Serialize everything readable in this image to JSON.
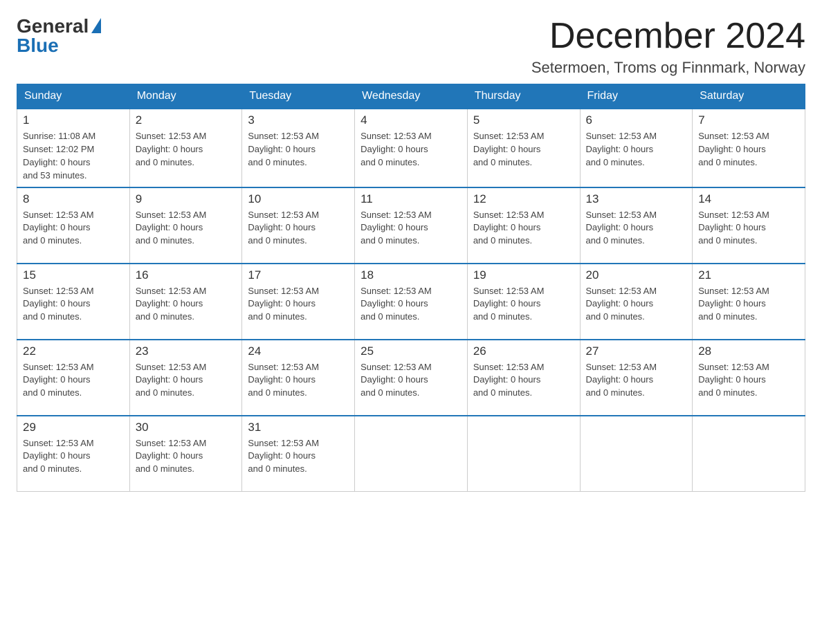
{
  "logo": {
    "general": "General",
    "blue": "Blue"
  },
  "title": {
    "month_year": "December 2024",
    "location": "Setermoen, Troms og Finnmark, Norway"
  },
  "headers": [
    "Sunday",
    "Monday",
    "Tuesday",
    "Wednesday",
    "Thursday",
    "Friday",
    "Saturday"
  ],
  "weeks": [
    [
      {
        "day": "1",
        "info": "Sunrise: 11:08 AM\nSunset: 12:02 PM\nDaylight: 0 hours\nand 53 minutes."
      },
      {
        "day": "2",
        "info": "Sunset: 12:53 AM\nDaylight: 0 hours\nand 0 minutes."
      },
      {
        "day": "3",
        "info": "Sunset: 12:53 AM\nDaylight: 0 hours\nand 0 minutes."
      },
      {
        "day": "4",
        "info": "Sunset: 12:53 AM\nDaylight: 0 hours\nand 0 minutes."
      },
      {
        "day": "5",
        "info": "Sunset: 12:53 AM\nDaylight: 0 hours\nand 0 minutes."
      },
      {
        "day": "6",
        "info": "Sunset: 12:53 AM\nDaylight: 0 hours\nand 0 minutes."
      },
      {
        "day": "7",
        "info": "Sunset: 12:53 AM\nDaylight: 0 hours\nand 0 minutes."
      }
    ],
    [
      {
        "day": "8",
        "info": "Sunset: 12:53 AM\nDaylight: 0 hours\nand 0 minutes."
      },
      {
        "day": "9",
        "info": "Sunset: 12:53 AM\nDaylight: 0 hours\nand 0 minutes."
      },
      {
        "day": "10",
        "info": "Sunset: 12:53 AM\nDaylight: 0 hours\nand 0 minutes."
      },
      {
        "day": "11",
        "info": "Sunset: 12:53 AM\nDaylight: 0 hours\nand 0 minutes."
      },
      {
        "day": "12",
        "info": "Sunset: 12:53 AM\nDaylight: 0 hours\nand 0 minutes."
      },
      {
        "day": "13",
        "info": "Sunset: 12:53 AM\nDaylight: 0 hours\nand 0 minutes."
      },
      {
        "day": "14",
        "info": "Sunset: 12:53 AM\nDaylight: 0 hours\nand 0 minutes."
      }
    ],
    [
      {
        "day": "15",
        "info": "Sunset: 12:53 AM\nDaylight: 0 hours\nand 0 minutes."
      },
      {
        "day": "16",
        "info": "Sunset: 12:53 AM\nDaylight: 0 hours\nand 0 minutes."
      },
      {
        "day": "17",
        "info": "Sunset: 12:53 AM\nDaylight: 0 hours\nand 0 minutes."
      },
      {
        "day": "18",
        "info": "Sunset: 12:53 AM\nDaylight: 0 hours\nand 0 minutes."
      },
      {
        "day": "19",
        "info": "Sunset: 12:53 AM\nDaylight: 0 hours\nand 0 minutes."
      },
      {
        "day": "20",
        "info": "Sunset: 12:53 AM\nDaylight: 0 hours\nand 0 minutes."
      },
      {
        "day": "21",
        "info": "Sunset: 12:53 AM\nDaylight: 0 hours\nand 0 minutes."
      }
    ],
    [
      {
        "day": "22",
        "info": "Sunset: 12:53 AM\nDaylight: 0 hours\nand 0 minutes."
      },
      {
        "day": "23",
        "info": "Sunset: 12:53 AM\nDaylight: 0 hours\nand 0 minutes."
      },
      {
        "day": "24",
        "info": "Sunset: 12:53 AM\nDaylight: 0 hours\nand 0 minutes."
      },
      {
        "day": "25",
        "info": "Sunset: 12:53 AM\nDaylight: 0 hours\nand 0 minutes."
      },
      {
        "day": "26",
        "info": "Sunset: 12:53 AM\nDaylight: 0 hours\nand 0 minutes."
      },
      {
        "day": "27",
        "info": "Sunset: 12:53 AM\nDaylight: 0 hours\nand 0 minutes."
      },
      {
        "day": "28",
        "info": "Sunset: 12:53 AM\nDaylight: 0 hours\nand 0 minutes."
      }
    ],
    [
      {
        "day": "29",
        "info": "Sunset: 12:53 AM\nDaylight: 0 hours\nand 0 minutes."
      },
      {
        "day": "30",
        "info": "Sunset: 12:53 AM\nDaylight: 0 hours\nand 0 minutes."
      },
      {
        "day": "31",
        "info": "Sunset: 12:53 AM\nDaylight: 0 hours\nand 0 minutes."
      },
      {
        "day": "",
        "info": ""
      },
      {
        "day": "",
        "info": ""
      },
      {
        "day": "",
        "info": ""
      },
      {
        "day": "",
        "info": ""
      }
    ]
  ]
}
